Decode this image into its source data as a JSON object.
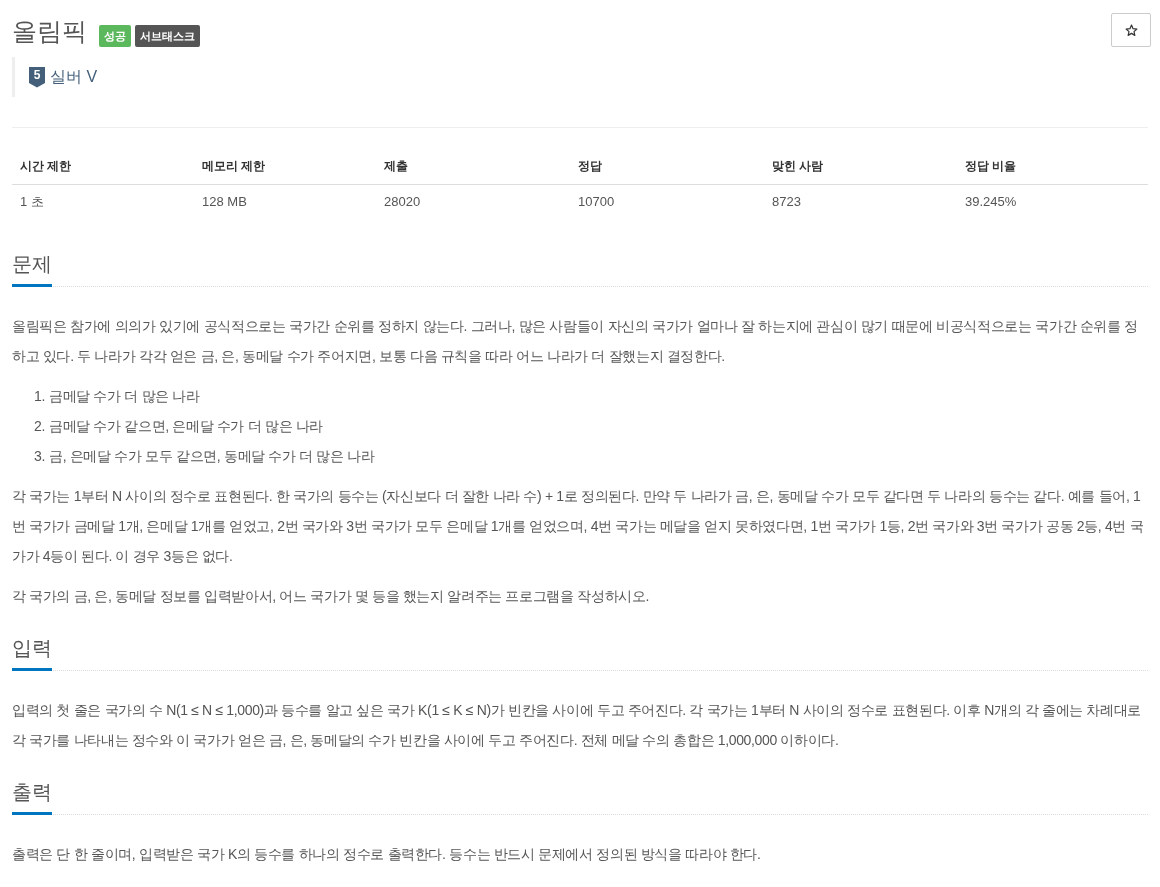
{
  "header": {
    "title": "올림픽",
    "badges": [
      {
        "label": "성공",
        "kind": "success"
      },
      {
        "label": "서브태스크",
        "kind": "subtask"
      }
    ],
    "tier": {
      "level": "5",
      "label": "실버 V"
    }
  },
  "info_table": {
    "columns": [
      "시간 제한",
      "메모리 제한",
      "제출",
      "정답",
      "맞힌 사람",
      "정답 비율"
    ],
    "rows": [
      [
        "1 초",
        "128 MB",
        "28020",
        "10700",
        "8723",
        "39.245%"
      ]
    ]
  },
  "sections": [
    {
      "heading": "문제",
      "blocks": [
        {
          "kind": "paragraph",
          "text": "올림픽은 참가에 의의가 있기에 공식적으로는 국가간 순위를 정하지 않는다. 그러나, 많은 사람들이 자신의 국가가 얼마나 잘 하는지에 관심이 많기 때문에 비공식적으로는 국가간 순위를 정하고 있다. 두 나라가 각각 얻은 금, 은, 동메달 수가 주어지면, 보통 다음 규칙을 따라 어느 나라가 더 잘했는지 결정한다."
        },
        {
          "kind": "ordered_list",
          "items": [
            {
              "number": "1.",
              "text": "금메달 수가 더 많은 나라"
            },
            {
              "number": "2.",
              "text": "금메달 수가 같으면, 은메달 수가 더 많은 나라"
            },
            {
              "number": "3.",
              "text": "금, 은메달 수가 모두 같으면, 동메달 수가 더 많은 나라"
            }
          ]
        },
        {
          "kind": "paragraph",
          "text": "각 국가는 1부터 N 사이의 정수로 표현된다. 한 국가의 등수는 (자신보다 더 잘한 나라 수) + 1로 정의된다. 만약 두 나라가 금, 은, 동메달 수가 모두 같다면 두 나라의 등수는 같다. 예를 들어, 1번 국가가 금메달 1개, 은메달 1개를 얻었고, 2번 국가와 3번 국가가 모두 은메달 1개를 얻었으며, 4번 국가는 메달을 얻지 못하였다면, 1번 국가가 1등, 2번 국가와 3번 국가가 공동 2등, 4번 국가가 4등이 된다. 이 경우 3등은 없다."
        },
        {
          "kind": "paragraph",
          "text": "각 국가의 금, 은, 동메달 정보를 입력받아서, 어느 국가가 몇 등을 했는지 알려주는 프로그램을 작성하시오."
        }
      ]
    },
    {
      "heading": "입력",
      "blocks": [
        {
          "kind": "paragraph",
          "text": "입력의 첫 줄은 국가의 수 N(1 ≤ N ≤ 1,000)과 등수를 알고 싶은 국가 K(1 ≤ K ≤ N)가 빈칸을 사이에 두고 주어진다. 각 국가는 1부터 N 사이의 정수로 표현된다. 이후 N개의 각 줄에는 차례대로 각 국가를 나타내는 정수와 이 국가가 얻은 금, 은, 동메달의 수가 빈칸을 사이에 두고 주어진다. 전체 메달 수의 총합은 1,000,000 이하이다."
        }
      ]
    },
    {
      "heading": "출력",
      "blocks": [
        {
          "kind": "paragraph",
          "text": "출력은 단 한 줄이며, 입력받은 국가 K의 등수를 하나의 정수로 출력한다. 등수는 반드시 문제에서 정의된 방식을 따라야 한다."
        }
      ]
    }
  ]
}
